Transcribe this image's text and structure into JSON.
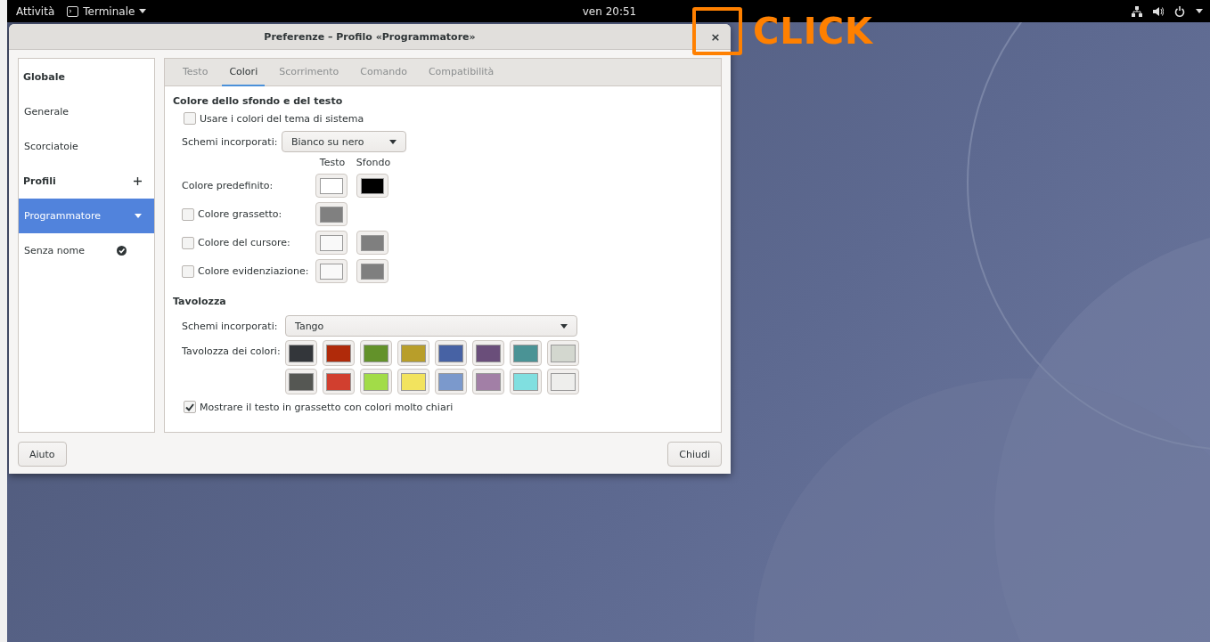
{
  "top_bar": {
    "activities": "Attività",
    "app_menu": "Terminale",
    "clock": "ven 20:51"
  },
  "dialog": {
    "title": "Preferenze – Profilo «Programmatore»",
    "close_button": "×"
  },
  "sidebar": {
    "items": [
      {
        "kind": "header",
        "label": "Globale",
        "selected": false
      },
      {
        "kind": "item",
        "label": "Generale",
        "selected": false
      },
      {
        "kind": "item",
        "label": "Scorciatoie",
        "selected": false
      },
      {
        "kind": "add_header",
        "label": "Profili",
        "selected": false
      },
      {
        "kind": "menu",
        "label": "Programmatore",
        "selected": true
      },
      {
        "kind": "default",
        "label": "Senza nome",
        "selected": false
      }
    ]
  },
  "tabs": [
    {
      "label": "Testo",
      "selected": false
    },
    {
      "label": "Colori",
      "selected": true
    },
    {
      "label": "Scorrimento",
      "selected": false
    },
    {
      "label": "Comando",
      "selected": false
    },
    {
      "label": "Compatibilità",
      "selected": false
    }
  ],
  "text_background": {
    "title": "Colore dello sfondo e del testo",
    "use_system_colors": {
      "label": "Usare i colori del tema di sistema",
      "checked": false
    },
    "schemes": {
      "label": "Schemi incorporati:",
      "value": "Bianco su nero"
    },
    "column_heads": [
      "Testo",
      "Sfondo"
    ],
    "color_rows": [
      {
        "kind": "plain",
        "label": "Colore predefinito:",
        "swatches": [
          {
            "color": "#ffffff"
          },
          {
            "color": "#000000"
          }
        ]
      },
      {
        "kind": "checkbox",
        "label": "Colore grassetto:",
        "checked": false,
        "swatches": [
          {
            "color": "#808080"
          }
        ]
      },
      {
        "kind": "checkbox",
        "label": "Colore del cursore:",
        "checked": false,
        "swatches": [
          {
            "color": "#f9f9f9"
          },
          {
            "color": "#7f7f7f"
          }
        ]
      },
      {
        "kind": "checkbox",
        "label": "Colore evidenziazione:",
        "checked": false,
        "swatches": [
          {
            "color": "#f9f9f9"
          },
          {
            "color": "#7f7f7f"
          }
        ]
      }
    ]
  },
  "palette": {
    "title": "Tavolozza",
    "schemes": {
      "label": "Schemi incorporati:",
      "value": "Tango"
    },
    "label": "Tavolozza dei colori:",
    "rows": [
      [
        {
          "color": "#33363a"
        },
        {
          "color": "#b02a0a"
        },
        {
          "color": "#63922a"
        },
        {
          "color": "#b89e2a"
        },
        {
          "color": "#4762a4"
        },
        {
          "color": "#6a4e7a"
        },
        {
          "color": "#4a9395"
        },
        {
          "color": "#d3d7cf"
        }
      ],
      [
        {
          "color": "#555753"
        },
        {
          "color": "#d13f2f"
        },
        {
          "color": "#a2dc48"
        },
        {
          "color": "#f2e35e"
        },
        {
          "color": "#7b99cc"
        },
        {
          "color": "#a27fa6"
        },
        {
          "color": "#80dfe0"
        },
        {
          "color": "#eeeeec"
        }
      ]
    ],
    "bold_bright": {
      "label": "Mostrare il testo in grassetto con colori molto chiari",
      "checked": true
    }
  },
  "buttons": [
    {
      "kind": "help",
      "label": "Aiuto"
    },
    {
      "kind": "close",
      "label": "Chiudi"
    }
  ],
  "annotation": {
    "text": "CLICK"
  }
}
